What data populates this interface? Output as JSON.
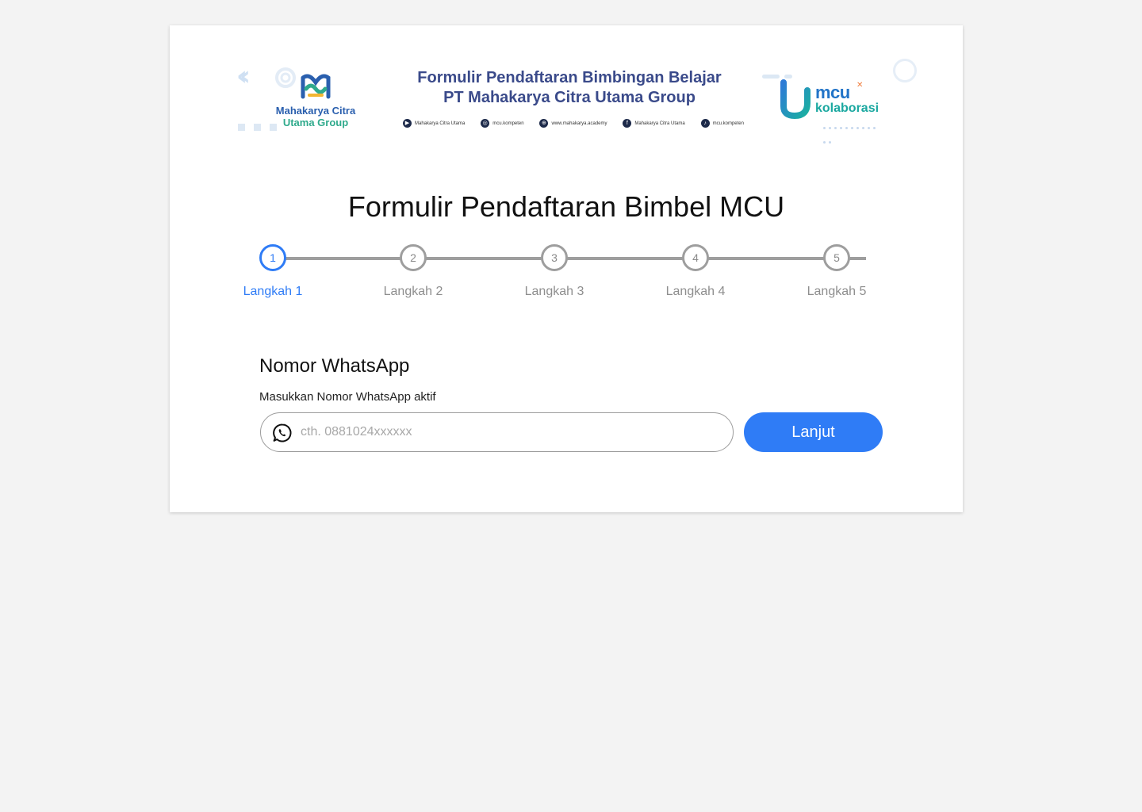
{
  "banner": {
    "left_logo": {
      "line1": "Mahakarya Citra",
      "line2": "Utama Group",
      "icon": "mcu-group-logo-icon"
    },
    "title_line1": "Formulir Pendaftaran Bimbingan Belajar",
    "title_line2": "PT Mahakarya Citra Utama Group",
    "socials": [
      {
        "icon": "youtube-icon",
        "label": "Mahakarya Citra Utama"
      },
      {
        "icon": "instagram-icon",
        "label": "mcu.kompeten"
      },
      {
        "icon": "globe-icon",
        "label": "www.mahakarya.academy"
      },
      {
        "icon": "facebook-icon",
        "label": "Mahakarya Citra Utama"
      },
      {
        "icon": "tiktok-icon",
        "label": "mcu.kompeten"
      }
    ],
    "right_logo": {
      "line1": "mcu",
      "line2": "kolaborasi",
      "icon": "mcu-kolaborasi-logo-icon"
    }
  },
  "form": {
    "title": "Formulir Pendaftaran Bimbel MCU",
    "steps": [
      {
        "number": "1",
        "label": "Langkah 1",
        "active": true
      },
      {
        "number": "2",
        "label": "Langkah 2",
        "active": false
      },
      {
        "number": "3",
        "label": "Langkah 3",
        "active": false
      },
      {
        "number": "4",
        "label": "Langkah 4",
        "active": false
      },
      {
        "number": "5",
        "label": "Langkah 5",
        "active": false
      }
    ],
    "section_title": "Nomor WhatsApp",
    "section_subtitle": "Masukkan Nomor WhatsApp aktif",
    "phone_input": {
      "value": "",
      "placeholder": "cth. 0881024xxxxxx",
      "icon": "whatsapp-icon"
    },
    "submit_label": "Lanjut"
  },
  "colors": {
    "accent": "#2f7cf6",
    "inactive_step": "#9e9e9e",
    "banner_title": "#3a4a8a",
    "background": "#f3f3f3"
  }
}
